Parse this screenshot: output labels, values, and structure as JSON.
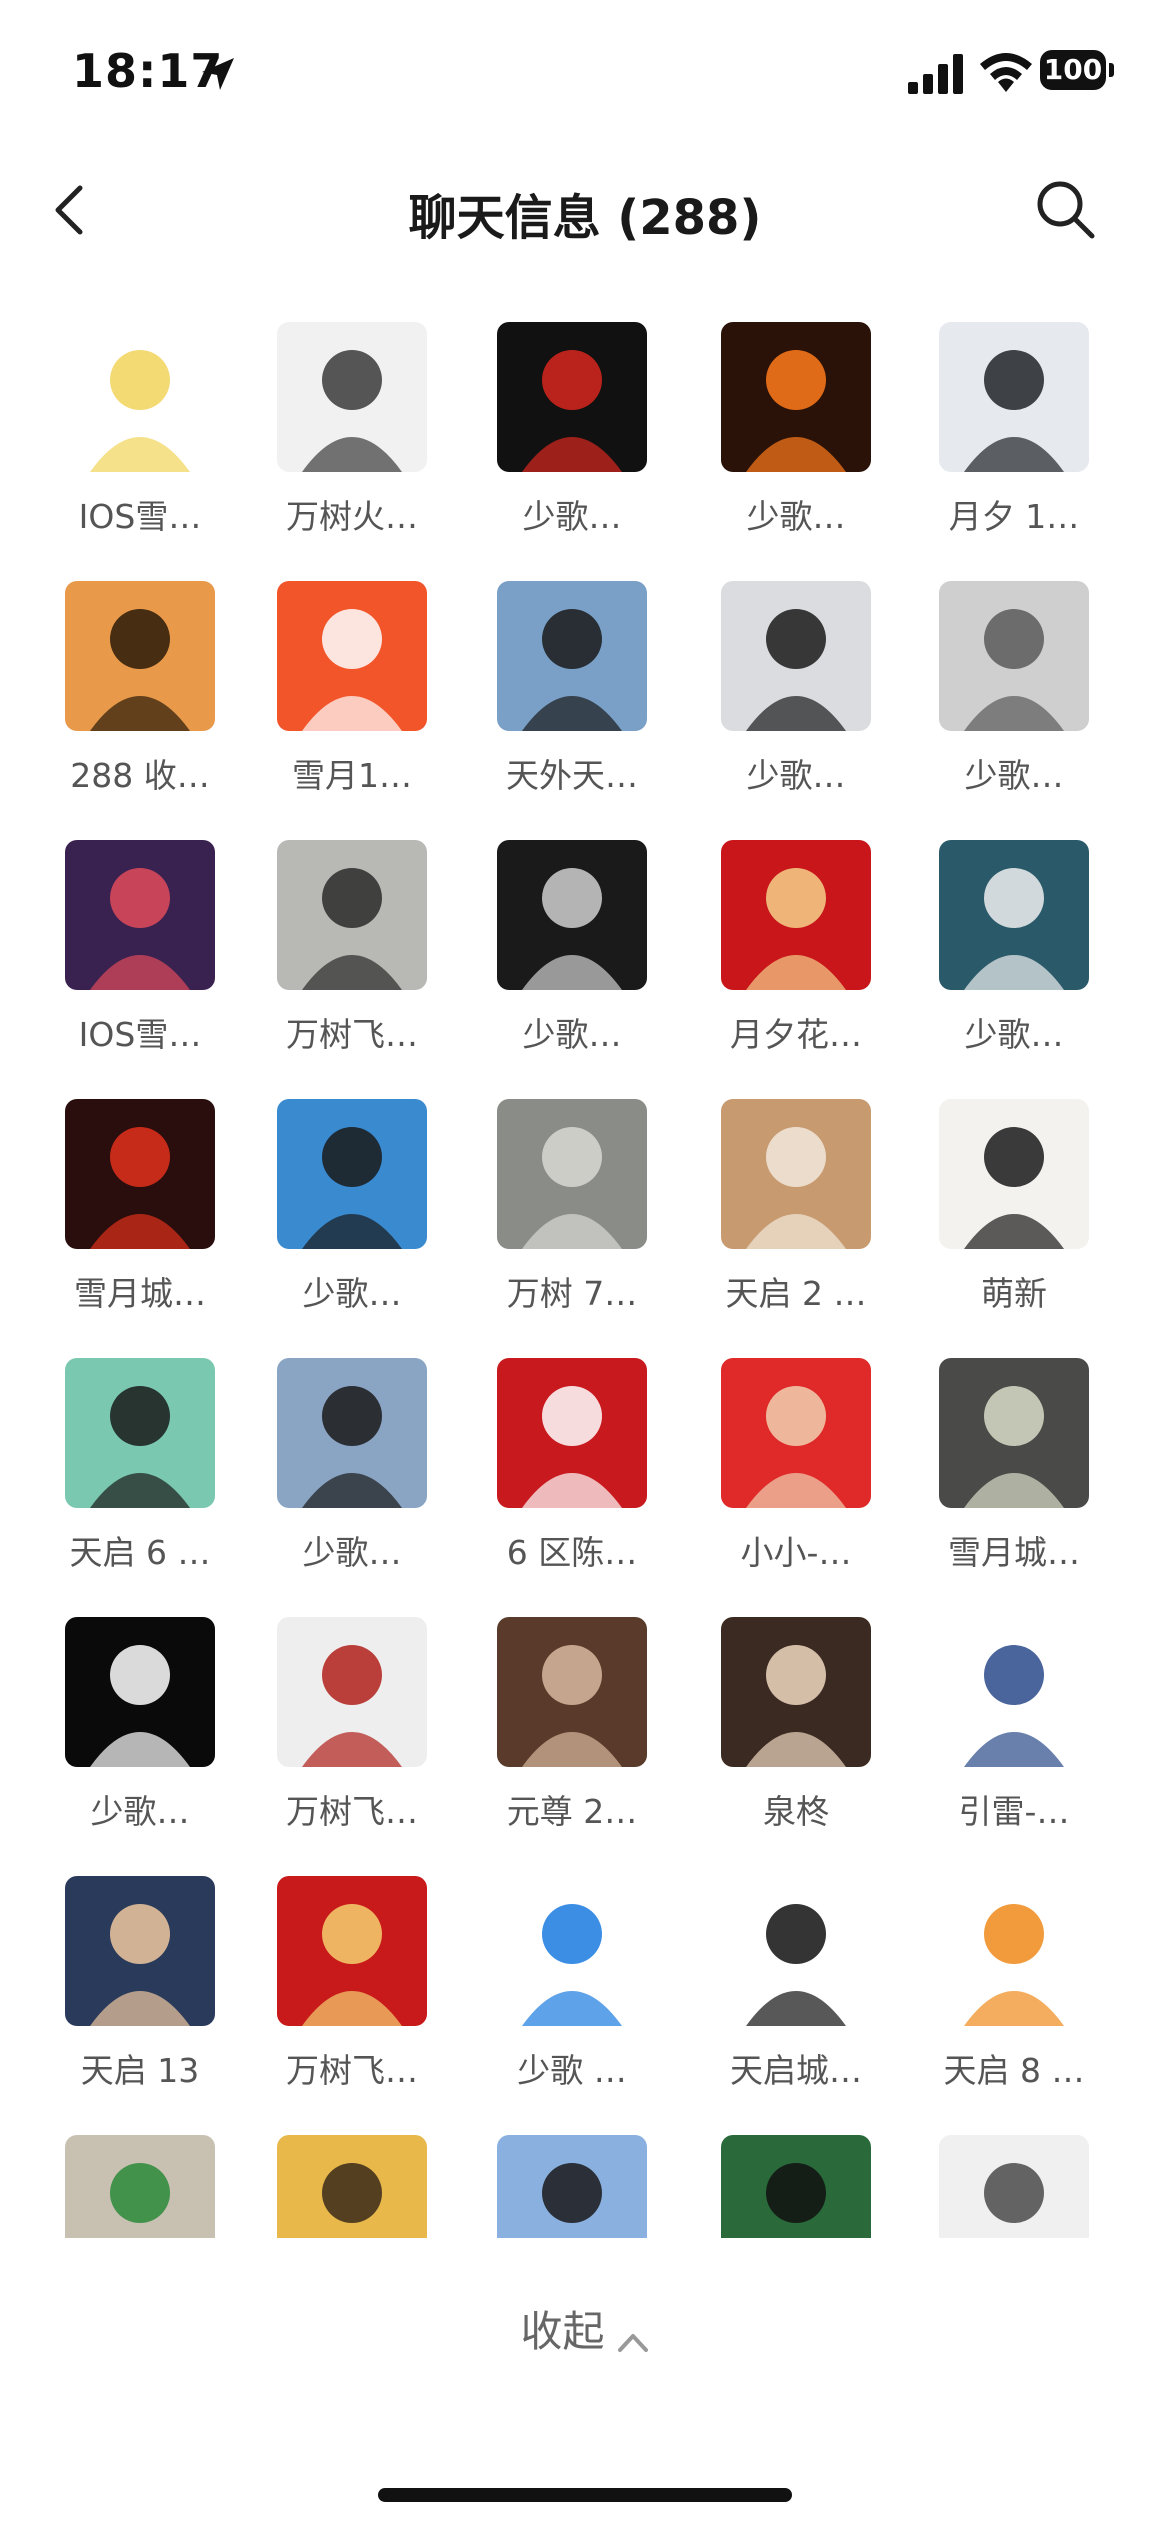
{
  "status_bar": {
    "time": "18:17",
    "battery": "100"
  },
  "nav": {
    "title": "聊天信息 (288)"
  },
  "members": [
    {
      "name": "IOS雪…",
      "bg": "#ffffff",
      "fg": "#f2d45a"
    },
    {
      "name": "万树火…",
      "bg": "#f1f1f1",
      "fg": "#3a3a3a"
    },
    {
      "name": "少歌…",
      "bg": "#111111",
      "fg": "#d8261f"
    },
    {
      "name": "少歌…",
      "bg": "#2a1208",
      "fg": "#ff7a1a"
    },
    {
      "name": "月夕 1…",
      "bg": "#e6e9ee",
      "fg": "#202428"
    },
    {
      "name": "288 收…",
      "bg": "#e89a4a",
      "fg": "#2a1a08"
    },
    {
      "name": "雪月1…",
      "bg": "#f2552a",
      "fg": "#ffffff"
    },
    {
      "name": "天外天…",
      "bg": "#7aa0c8",
      "fg": "#1a1a1a"
    },
    {
      "name": "少歌…",
      "bg": "#dadcdf",
      "fg": "#1a1a1a"
    },
    {
      "name": "少歌…",
      "bg": "#cfcfcf",
      "fg": "#5a5a5a"
    },
    {
      "name": "IOS雪…",
      "bg": "#3a2250",
      "fg": "#e04a5a"
    },
    {
      "name": "万树飞…",
      "bg": "#b8b8b4",
      "fg": "#2a2a2a"
    },
    {
      "name": "少歌…",
      "bg": "#1a1a1a",
      "fg": "#d0d0d0"
    },
    {
      "name": "月夕花…",
      "bg": "#c8161a",
      "fg": "#f5d08a"
    },
    {
      "name": "少歌…",
      "bg": "#2a5a6a",
      "fg": "#f0f0f0"
    },
    {
      "name": "雪月城…",
      "bg": "#2a0e0e",
      "fg": "#e0301a"
    },
    {
      "name": "少歌…",
      "bg": "#3a8ad0",
      "fg": "#1a1a1a"
    },
    {
      "name": "万树 7…",
      "bg": "#8a8c88",
      "fg": "#d8d8d4"
    },
    {
      "name": "天启 2 …",
      "bg": "#c89a70",
      "fg": "#f2e8dc"
    },
    {
      "name": "萌新",
      "bg": "#f4f2ee",
      "fg": "#1a1a1a"
    },
    {
      "name": "天启 6 …",
      "bg": "#7ac8b0",
      "fg": "#1a1a1a"
    },
    {
      "name": "少歌…",
      "bg": "#8aa4c4",
      "fg": "#1a1a1a"
    },
    {
      "name": "6 区陈…",
      "bg": "#c81a1e",
      "fg": "#ffffff"
    },
    {
      "name": "小小-…",
      "bg": "#e02a2a",
      "fg": "#f0d0b0"
    },
    {
      "name": "雪月城…",
      "bg": "#4a4a48",
      "fg": "#d8dcc8"
    },
    {
      "name": "少歌…",
      "bg": "#0a0a0a",
      "fg": "#ffffff"
    },
    {
      "name": "万树飞…",
      "bg": "#eeeeee",
      "fg": "#b0201a"
    },
    {
      "name": "元尊 2…",
      "bg": "#5a3a2a",
      "fg": "#d8b8a0"
    },
    {
      "name": "泉柊",
      "bg": "#3a2a22",
      "fg": "#f0d8c0"
    },
    {
      "name": "引雷-…",
      "bg": "#ffffff",
      "fg": "#2a4a8a"
    },
    {
      "name": "天启 13",
      "bg": "#2a3a5a",
      "fg": "#f0c8a0"
    },
    {
      "name": "万树飞…",
      "bg": "#c81a1a",
      "fg": "#f5d070"
    },
    {
      "name": "少歌 …",
      "bg": "#ffffff",
      "fg": "#1a7ae0"
    },
    {
      "name": "天启城…",
      "bg": "#ffffff",
      "fg": "#111111"
    },
    {
      "name": "天启 8 …",
      "bg": "#ffffff",
      "fg": "#f08a1a"
    },
    {
      "name": "",
      "bg": "#c8c0b0",
      "fg": "#2a8a3a"
    },
    {
      "name": "",
      "bg": "#e8b84a",
      "fg": "#3a2a1a"
    },
    {
      "name": "",
      "bg": "#8ab0e0",
      "fg": "#1a1a1a"
    },
    {
      "name": "",
      "bg": "#2a6a3a",
      "fg": "#111111"
    },
    {
      "name": "",
      "bg": "#f0f0f0",
      "fg": "#4a4a4a"
    }
  ],
  "collapse": {
    "label": "收起"
  }
}
